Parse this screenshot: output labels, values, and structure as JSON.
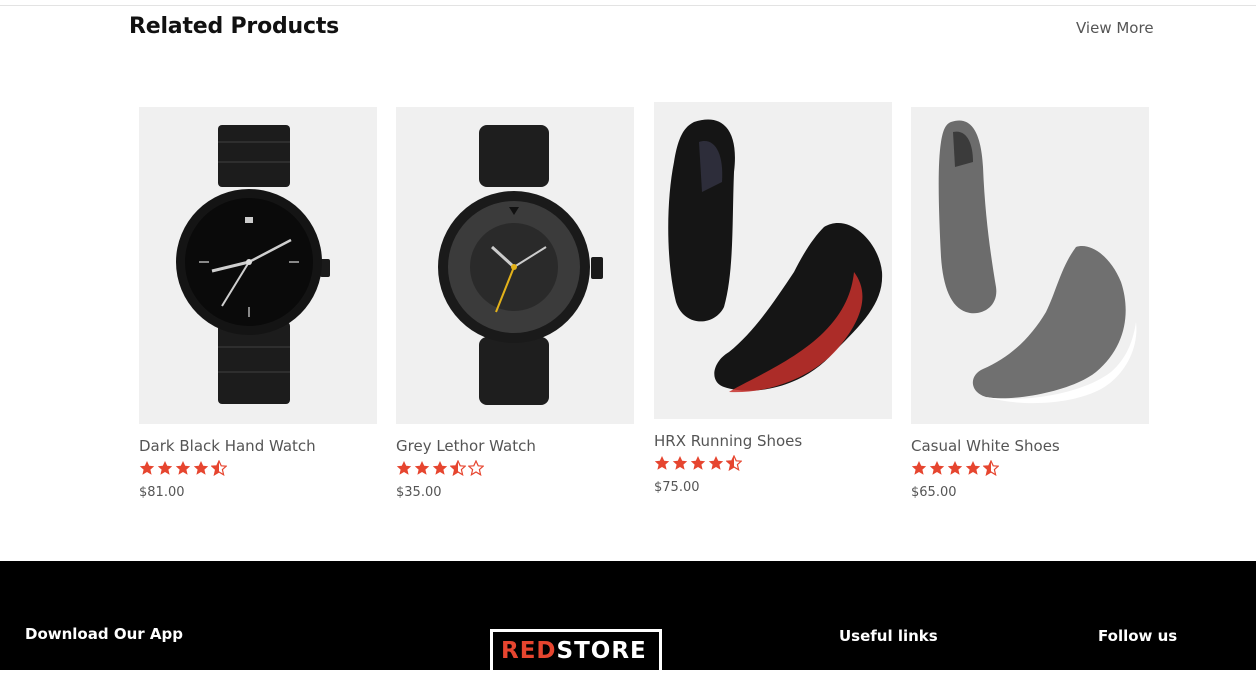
{
  "section": {
    "title": "Related Products",
    "view_more": "View More"
  },
  "products": [
    {
      "name": "Dark Black Hand Watch",
      "rating": 4.5,
      "price": "$81.00",
      "image": "black-metal-watch"
    },
    {
      "name": "Grey Lethor Watch",
      "rating": 3.5,
      "price": "$35.00",
      "image": "grey-leather-watch"
    },
    {
      "name": "HRX Running Shoes",
      "rating": 4.5,
      "price": "$75.00",
      "image": "black-red-running-shoes"
    },
    {
      "name": "Casual White Shoes",
      "rating": 4.5,
      "price": "$65.00",
      "image": "grey-slip-on-shoes"
    }
  ],
  "footer": {
    "download_app": "Download Our App",
    "logo_red": "RED",
    "logo_white": "STORE",
    "useful_links": "Useful links",
    "follow_us": "Follow us"
  },
  "colors": {
    "star": "#e6452f",
    "footer_bg": "#000000",
    "image_bg": "#f0f0f0"
  },
  "icons": [
    "star-full-icon",
    "star-half-icon",
    "star-empty-icon"
  ]
}
